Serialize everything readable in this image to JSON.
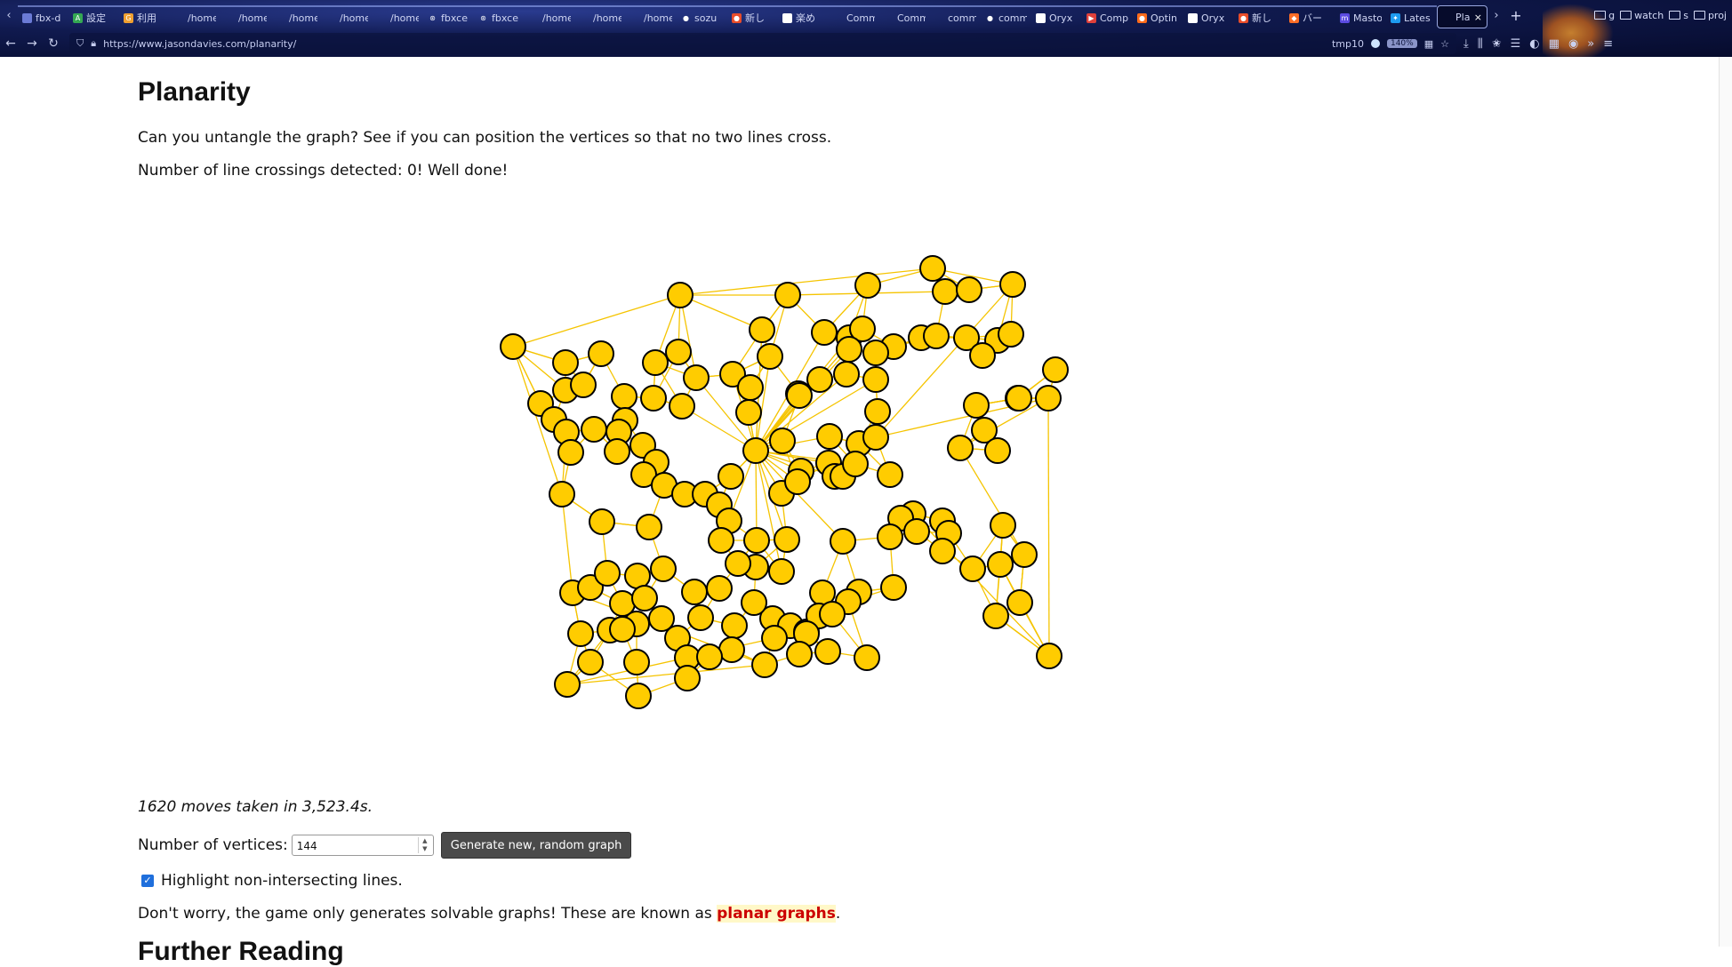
{
  "browser": {
    "tabs": [
      {
        "label": "fbx-d",
        "color": "#6b7bd6",
        "glyph": ""
      },
      {
        "label": "設定",
        "color": "#34a853",
        "glyph": "A"
      },
      {
        "label": "利用",
        "color": "#f0a030",
        "glyph": "G"
      },
      {
        "label": "/home/lo",
        "color": "",
        "glyph": ""
      },
      {
        "label": "/home/lo",
        "color": "",
        "glyph": ""
      },
      {
        "label": "/home/lo",
        "color": "",
        "glyph": ""
      },
      {
        "label": "/home/lo",
        "color": "",
        "glyph": ""
      },
      {
        "label": "/home/lo",
        "color": "",
        "glyph": ""
      },
      {
        "label": "fbxce",
        "color": "#ffffff",
        "glyph": "⊛"
      },
      {
        "label": "fbxce",
        "color": "#ffffff",
        "glyph": "⊛"
      },
      {
        "label": "/home/lo",
        "color": "",
        "glyph": ""
      },
      {
        "label": "/home/lo",
        "color": "",
        "glyph": ""
      },
      {
        "label": "/home/lo",
        "color": "",
        "glyph": ""
      },
      {
        "label": "sozu",
        "color": "#ffffff",
        "glyph": "●"
      },
      {
        "label": "新し",
        "color": "#e94d2a",
        "glyph": "●"
      },
      {
        "label": "楽め",
        "color": "#ffffff",
        "glyph": "✱"
      },
      {
        "label": "Common",
        "color": "",
        "glyph": ""
      },
      {
        "label": "Commons",
        "color": "",
        "glyph": ""
      },
      {
        "label": "common",
        "color": "",
        "glyph": ""
      },
      {
        "label": "comm",
        "color": "#ffffff",
        "glyph": "●"
      },
      {
        "label": "Oryx",
        "color": "#ffffff",
        "glyph": "✎"
      },
      {
        "label": "Comp",
        "color": "#e0403a",
        "glyph": "▶"
      },
      {
        "label": "Optin",
        "color": "#ff6b1a",
        "glyph": "●"
      },
      {
        "label": "Oryx",
        "color": "#ffffff",
        "glyph": "✎"
      },
      {
        "label": "新し",
        "color": "#e94d2a",
        "glyph": "●"
      },
      {
        "label": "バー",
        "color": "#fc6d26",
        "glyph": "◆"
      },
      {
        "label": "Masto",
        "color": "#5b4be1",
        "glyph": "m"
      },
      {
        "label": "Lates",
        "color": "#1d9bf0",
        "glyph": "✦"
      },
      {
        "label": "Pla",
        "color": "",
        "glyph": "",
        "active": true
      }
    ],
    "bookmarks": [
      "g",
      "watch",
      "s",
      "proj"
    ],
    "url": "https://www.jasondavies.com/planarity/",
    "tmp_label": "tmp10",
    "zoom": "140%"
  },
  "page": {
    "title": "Planarity",
    "intro": "Can you untangle the graph? See if you can position the vertices so that no two lines cross.",
    "status": "Number of line crossings detected: 0! Well done!",
    "moves": "1620 moves taken in 3,523.4s.",
    "vertices_label": "Number of vertices:",
    "vertices_value": "144",
    "generate_label": "Generate new, random graph",
    "highlight_label": "Highlight non-intersecting lines.",
    "highlight_checked": true,
    "footer_prefix": "Don't worry, the game only generates solvable graphs! These are known as",
    "footer_link": "planar graphs",
    "footer_suffix": ".",
    "further_heading": "Further Reading"
  },
  "graph": {
    "line_color": "#f5c400",
    "vertex_color": "#ffcc00",
    "crossings": 0,
    "vertex_count": 144
  }
}
